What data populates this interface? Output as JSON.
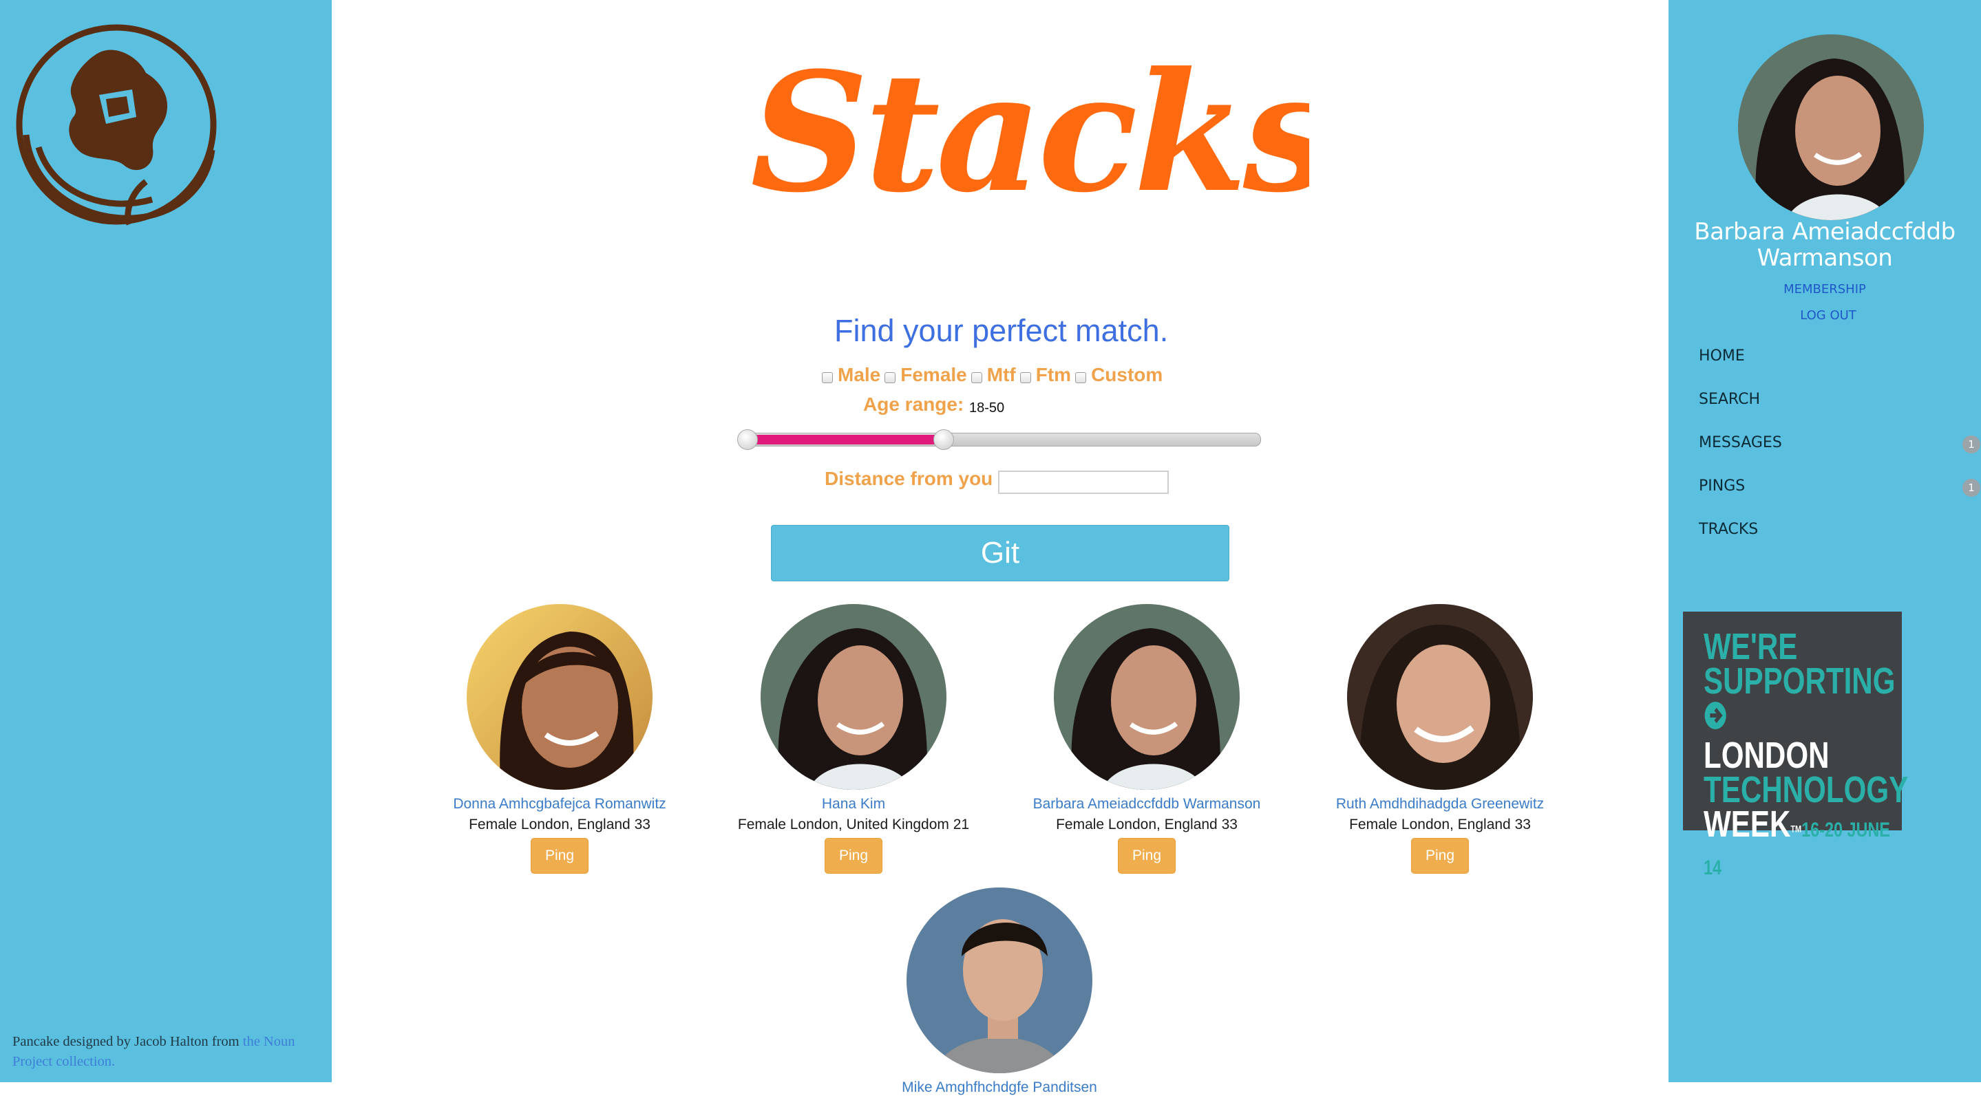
{
  "brand": {
    "title": "Stacksy",
    "color": "#ff6a10"
  },
  "colors": {
    "sidebar": "#5bbfe0",
    "accent_orange": "#f0a24a",
    "slider_pink": "#e0197a"
  },
  "left_sidebar": {
    "logo_icon": "pancake-icon",
    "credit_text": "Pancake designed by Jacob Halton from ",
    "credit_link": "the Noun Project collection."
  },
  "search": {
    "tagline": "Find your perfect match.",
    "genders": [
      "Male",
      "Female",
      "Mtf",
      "Ftm",
      "Custom"
    ],
    "age_label": "Age range:",
    "age_value": "18-50",
    "age_slider": {
      "min": 18,
      "max": 100,
      "low": 18,
      "high": 50
    },
    "distance_label": "Distance from you",
    "distance_value": "",
    "submit_label": "Git"
  },
  "results": [
    {
      "name": "Donna Amhcgbafejca Romanwitz",
      "info": "Female London, England 33",
      "ping": "Ping"
    },
    {
      "name": "Hana Kim",
      "info": "Female London, United Kingdom 21",
      "ping": "Ping"
    },
    {
      "name": "Barbara Ameiadccfddb Warmanson",
      "info": "Female London, England 33",
      "ping": "Ping"
    },
    {
      "name": "Ruth Amdhdihadgda Greenewitz",
      "info": "Female London, England 33",
      "ping": "Ping"
    },
    {
      "name": "Mike Amghfhchdgfe Panditsen",
      "info": "",
      "ping": ""
    }
  ],
  "profile": {
    "name_line1": "Barbara Ameiadccfddb",
    "name_line2": "Warmanson",
    "membership": "MEMBERSHIP",
    "logout": "LOG OUT"
  },
  "nav": [
    {
      "label": "HOME",
      "badge": ""
    },
    {
      "label": "SEARCH",
      "badge": ""
    },
    {
      "label": "MESSAGES",
      "badge": "1"
    },
    {
      "label": "PINGS",
      "badge": "1"
    },
    {
      "label": "TRACKS",
      "badge": ""
    }
  ],
  "promo": {
    "line1": "WE'RE",
    "line2": "SUPPORTING",
    "line3": "LONDON",
    "line4": "TECHNOLOGY",
    "line5": "WEEK",
    "trademark": "TM",
    "dates": "16-20 JUNE 14"
  }
}
